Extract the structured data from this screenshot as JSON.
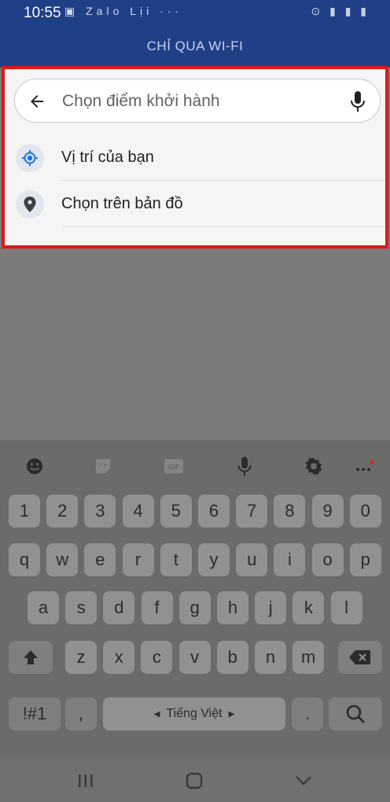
{
  "status": {
    "time": "10:55",
    "left_icons": "▣ Zalo Lịi ···",
    "right_icons": "⊙ ▮ ▮ ▮"
  },
  "header": {
    "title": "CHỈ QUA WI-FI"
  },
  "search": {
    "placeholder": "Chọn điểm khởi hành",
    "value": ""
  },
  "options": [
    {
      "label": "Vị trí của bạn",
      "icon": "location-target-icon"
    },
    {
      "label": "Chọn trên bản đồ",
      "icon": "map-pin-icon"
    }
  ],
  "keyboard": {
    "row_numbers": [
      "1",
      "2",
      "3",
      "4",
      "5",
      "6",
      "7",
      "8",
      "9",
      "0"
    ],
    "row1": [
      "q",
      "w",
      "e",
      "r",
      "t",
      "y",
      "u",
      "i",
      "o",
      "p"
    ],
    "row2": [
      "a",
      "s",
      "d",
      "f",
      "g",
      "h",
      "j",
      "k",
      "l"
    ],
    "row3": [
      "z",
      "x",
      "c",
      "v",
      "b",
      "n",
      "m"
    ],
    "symbols_label": "!#1",
    "comma": ",",
    "space_label": "Tiếng Việt",
    "period": "."
  },
  "toolbar": [
    "emoji-icon",
    "sticker-icon",
    "gif-icon",
    "mic-icon",
    "settings-icon",
    "more-icon"
  ],
  "colors": {
    "header": "#1f3f86",
    "highlight_border": "#e01818",
    "panel": "#f5f5f5",
    "keyboard": "#6b6b6b",
    "key": "#919191"
  }
}
